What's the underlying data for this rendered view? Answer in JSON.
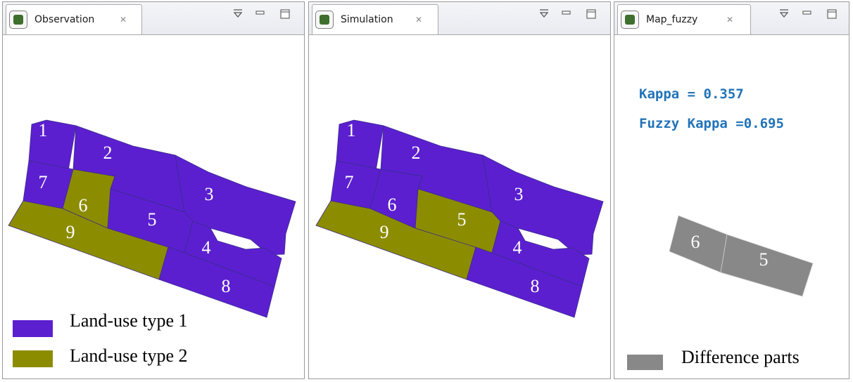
{
  "colors": {
    "land_use_1": "#5b1fd0",
    "land_use_2": "#8c8c00",
    "difference": "#888888",
    "stat_text": "#2173b8",
    "tab_icon": "#3e6f2c"
  },
  "panels": {
    "observation": {
      "tab_label": "Observation",
      "tab_close_icon": "close-tab-icon",
      "parcels": {
        "p1": "1",
        "p2": "2",
        "p3": "3",
        "p4": "4",
        "p5": "5",
        "p6": "6",
        "p7": "7",
        "p8": "8",
        "p9": "9"
      },
      "parcel_types": {
        "1": 1,
        "2": 1,
        "3": 1,
        "4": 1,
        "5": 1,
        "6": 2,
        "7": 1,
        "8": 1,
        "9": 2
      },
      "legend": [
        {
          "label": "Land-use type 1"
        },
        {
          "label": "Land-use type 2"
        }
      ]
    },
    "simulation": {
      "tab_label": "Simulation",
      "tab_close_icon": "close-tab-icon",
      "parcels": {
        "p1": "1",
        "p2": "2",
        "p3": "3",
        "p4": "4",
        "p5": "5",
        "p6": "6",
        "p7": "7",
        "p8": "8",
        "p9": "9"
      },
      "parcel_types": {
        "1": 1,
        "2": 1,
        "3": 1,
        "4": 1,
        "5": 2,
        "6": 1,
        "7": 1,
        "8": 1,
        "9": 2
      }
    },
    "map_fuzzy": {
      "tab_label": "Map_fuzzy",
      "tab_close_icon": "close-tab-icon",
      "kappa": "Kappa = 0.357",
      "fuzzy_kappa": "Fuzzy Kappa =0.695",
      "parcels": {
        "p5": "5",
        "p6": "6"
      },
      "legend_label": "Difference parts"
    }
  },
  "view_controls": [
    "view-menu-icon",
    "minimize-icon",
    "maximize-icon"
  ]
}
